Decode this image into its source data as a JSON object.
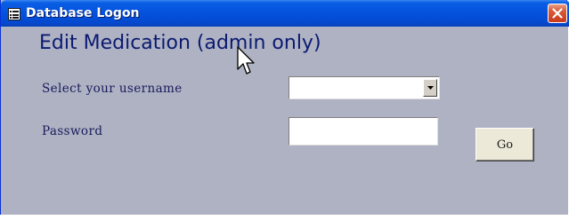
{
  "window": {
    "title": "Database Logon",
    "icon": "form-icon",
    "close_icon": "close-icon",
    "titlebar_color": "#0553de",
    "background_color": "#aeb2c3"
  },
  "form": {
    "heading": "Edit Medication (admin only)",
    "username_label": "Select your username",
    "username_value": "",
    "password_label": "Password",
    "password_value": "",
    "go_label": "Go",
    "heading_color": "#0b1a70"
  }
}
